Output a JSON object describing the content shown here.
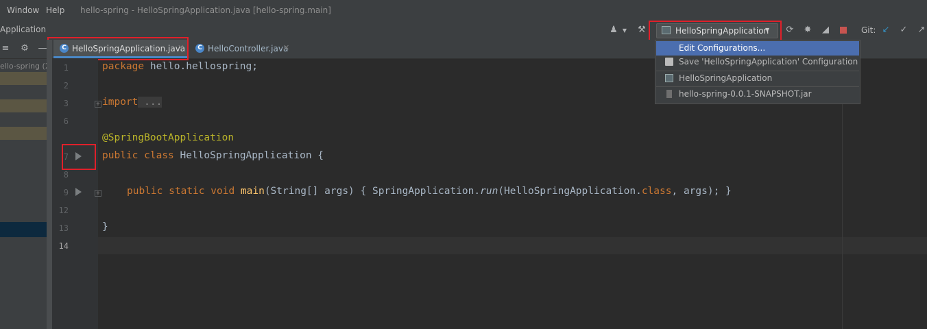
{
  "menu": {
    "window": "Window",
    "help": "Help"
  },
  "window_title": "hello-spring - HelloSpringApplication.java [hello-spring.main]",
  "breadcrumb": "Application",
  "project_panel": {
    "root_label": "ello-spring (2"
  },
  "run_config": {
    "selected": "HelloSpringApplication"
  },
  "git_label": "Git:",
  "tabs": [
    {
      "label": "HelloSpringApplication.java",
      "active": true
    },
    {
      "label": "HelloController.java",
      "active": false
    }
  ],
  "dropdown": {
    "items": [
      {
        "label": "Edit Configurations...",
        "highlighted": true,
        "icon": "none"
      },
      {
        "label": "Save 'HelloSpringApplication' Configuration",
        "icon": "save-icon"
      },
      {
        "label": "HelloSpringApplication",
        "icon": "spring-config-icon"
      },
      {
        "label": "hello-spring-0.0.1-SNAPSHOT.jar",
        "icon": "jar-icon"
      }
    ]
  },
  "editor": {
    "line_numbers": [
      "1",
      "2",
      "3",
      "6",
      "7",
      "8",
      "9",
      "12",
      "13",
      "14"
    ],
    "lines": {
      "l1_kw": "package",
      "l1_rest": " hello.hellospring;",
      "l3_kw": "import",
      "l3_rest": " ...",
      "l6": "@SpringBootApplication",
      "l7_kw1": "public",
      "l7_kw2": "class",
      "l7_rest": "HelloSpringApplication {",
      "l9_kw1": "public",
      "l9_kw2": "static",
      "l9_kw3": "void",
      "l9_name": "main",
      "l9_args": "(String[] args) { SpringApplication.",
      "l9_run": "run",
      "l9_args2": "(HelloSpringApplication.",
      "l9_class": "class",
      "l9_end": ", args); }",
      "l13": "}"
    }
  },
  "colors": {
    "keyword": "#cc7832",
    "annotation": "#bbb529",
    "text": "#a9b7c6",
    "highlight": "#4b6eaf",
    "red_box": "#e0202a"
  }
}
